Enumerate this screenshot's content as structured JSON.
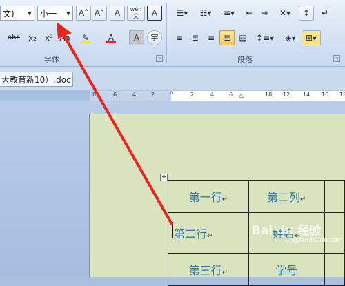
{
  "ribbon": {
    "font_name_value": "文)",
    "font_size_value": "小一",
    "group_font_label": "字体",
    "group_paragraph_label": "段落",
    "btn_grow_font": "A˄",
    "btn_shrink_font": "A˅",
    "btn_clear_format": "A",
    "btn_phonetic": "wén 文",
    "btn_char_border": "A",
    "btn_strikethrough": "abc",
    "btn_subscript": "x₂",
    "btn_superscript": "x²",
    "btn_change_case": "Aa",
    "btn_font_color": "A",
    "btn_char_shading": "A",
    "btn_enclose": "字"
  },
  "document_tab": {
    "label": "大教育新10）.doc"
  },
  "ruler": {
    "ticks": [
      "8",
      "6",
      "4",
      "2",
      "",
      "2",
      "4",
      "6",
      "",
      "10",
      "12",
      "14",
      "16",
      "18"
    ]
  },
  "table": {
    "rows": [
      [
        "第一行",
        "第二列",
        ""
      ],
      [
        "第二行",
        "姓名",
        ""
      ],
      [
        "第三行",
        "学号",
        ""
      ]
    ],
    "cell_marker": "↵"
  },
  "watermark": {
    "text": "Bai du 经验",
    "sub": "jingyan.baidu.com"
  },
  "colors": {
    "arrow": "#e8261d",
    "text_blue": "#2c78b4",
    "page": "#d9e4bf"
  }
}
